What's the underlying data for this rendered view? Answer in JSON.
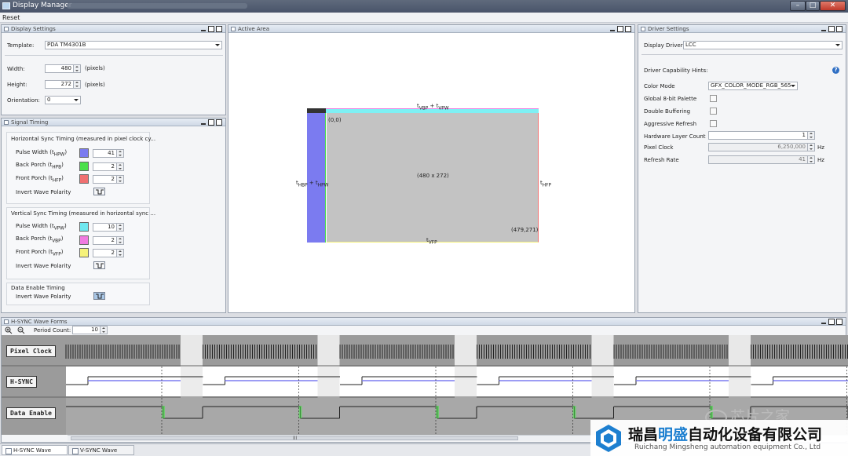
{
  "window": {
    "title": "Display Manager"
  },
  "menu": {
    "reset": "Reset"
  },
  "display_settings": {
    "title": "Display Settings",
    "template_label": "Template:",
    "template_value": "PDA TM4301B",
    "width_label": "Width:",
    "width_value": "480",
    "width_unit": "(pixels)",
    "height_label": "Height:",
    "height_value": "272",
    "height_unit": "(pixels)",
    "orientation_label": "Orientation:",
    "orientation_value": "0"
  },
  "signal_timing": {
    "title": "Signal Timing",
    "h_heading": "Horizontal Sync Timing (measured in pixel clock cy...",
    "h_pulse_label": "Pulse Width (t",
    "h_pulse_sub": "HPW",
    "h_pulse_value": "41",
    "h_back_label": "Back Porch (t",
    "h_back_sub": "HPB",
    "h_back_value": "2",
    "h_front_label": "Front Porch (t",
    "h_front_sub": "HFP",
    "h_front_value": "2",
    "h_invert": "Invert Wave Polarity",
    "v_heading": "Vertical Sync Timing  (measured in horizontal sync ...",
    "v_pulse_label": "Pulse Width (t",
    "v_pulse_sub": "VPW",
    "v_pulse_value": "10",
    "v_back_label": "Back Porch (t",
    "v_back_sub": "VBP",
    "v_back_value": "2",
    "v_front_label": "Front Porch (t",
    "v_front_sub": "VFP",
    "v_front_value": "2",
    "v_invert": "Invert Wave Polarity",
    "de_heading": "Data Enable Timing",
    "de_invert": "Invert Wave Polarity",
    "colors": {
      "h_pulse": "#7b7bf0",
      "h_back": "#4be04b",
      "h_front": "#f07070",
      "v_pulse": "#6fe8f0",
      "v_back": "#f07ae0",
      "v_front": "#f6f27a"
    }
  },
  "active_area": {
    "title": "Active Area",
    "top_label": "t",
    "top_sub1": "VBP",
    "top_plus": " + t",
    "top_sub2": "VPW",
    "left_label": "t",
    "left_sub1": "HBP",
    "left_plus": " + t",
    "left_sub2": "HPW",
    "right_label": "t",
    "right_sub": "HFP",
    "bottom_label": "t",
    "bottom_sub": "VFP",
    "origin": "(0,0)",
    "size": "(480 x 272)",
    "end": "(479,271)"
  },
  "driver_settings": {
    "title": "Driver Settings",
    "driver_label": "Display Driver:",
    "driver_value": "LCC",
    "hints": "Driver Capability Hints:",
    "color_mode_label": "Color Mode",
    "color_mode_value": "GFX_COLOR_MODE_RGB_565",
    "palette_label": "Global 8-bit Palette",
    "double_label": "Double Buffering",
    "aggressive_label": "Aggressive Refresh",
    "layer_label": "Hardware Layer Count",
    "layer_value": "1",
    "pixel_clock_label": "Pixel Clock",
    "pixel_clock_value": "6,250,000",
    "pixel_clock_unit": "Hz",
    "refresh_label": "Refresh Rate",
    "refresh_value": "41",
    "refresh_unit": "Hz"
  },
  "hsync_panel": {
    "title": "H-SYNC Wave Forms",
    "period_label": "Period Count:",
    "period_value": "10",
    "signals": [
      "Pixel Clock",
      "H-SYNC",
      "Data Enable"
    ],
    "scroll_mark": "III"
  },
  "tabs": [
    "H-SYNC Wave Forms",
    "V-SYNC Wave Forms"
  ],
  "watermark": {
    "wechat": "芯片之家",
    "cn_pre": "瑞昌",
    "cn_hl": "明盛",
    "cn_post": "自动化设备有限公司",
    "en": "Ruichang Mingsheng automation equipment Co., Ltd"
  }
}
